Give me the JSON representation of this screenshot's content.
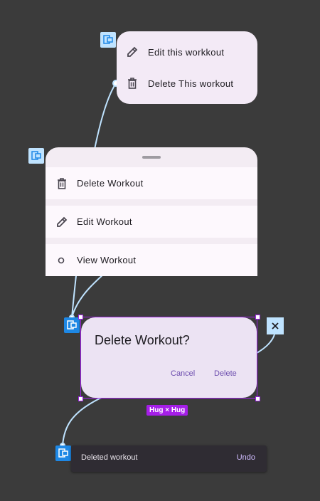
{
  "menu": {
    "items": [
      {
        "label": "Edit this workkout",
        "icon": "pencil-icon"
      },
      {
        "label": "Delete This workout",
        "icon": "trash-icon"
      }
    ]
  },
  "sheet": {
    "items": [
      {
        "label": "Delete Workout",
        "icon": "trash-icon"
      },
      {
        "label": "Edit Workout",
        "icon": "pencil-icon"
      },
      {
        "label": "View Workout",
        "icon": "circle-icon"
      }
    ]
  },
  "dialog": {
    "title": "Delete Workout?",
    "cancel_label": "Cancel",
    "delete_label": "Delete",
    "size_badge": "Hug × Hug"
  },
  "snackbar": {
    "message": "Deleted workout",
    "action_label": "Undo"
  },
  "colors": {
    "canvas": "#3b3b3b",
    "connector": "#bfe3ff",
    "selection": "#a024e6",
    "surface": "#f3eaf6"
  }
}
